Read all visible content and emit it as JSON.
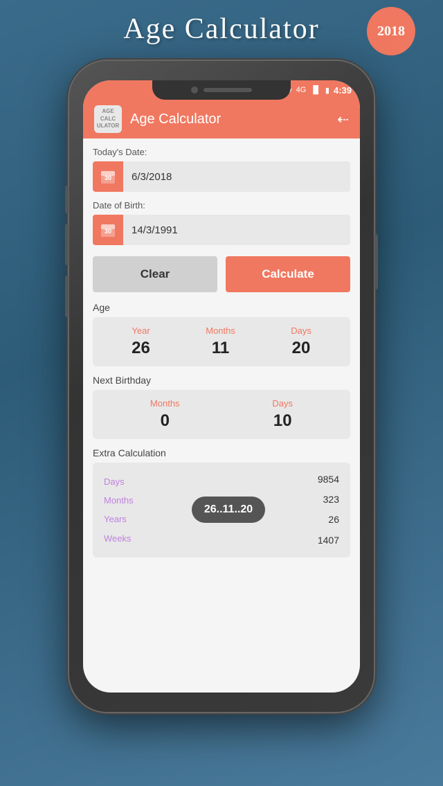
{
  "app": {
    "main_title": "Age Calculator",
    "year_badge": "2018",
    "app_title": "Age Calculator"
  },
  "status_bar": {
    "network": "4G",
    "time": "4:39"
  },
  "form": {
    "today_label": "Today's Date:",
    "today_value": "6/3/2018",
    "dob_label": "Date of Birth:",
    "dob_value": "14/3/1991",
    "clear_button": "Clear",
    "calculate_button": "Calculate"
  },
  "age_section": {
    "label": "Age",
    "year_label": "Year",
    "year_value": "26",
    "months_label": "Months",
    "months_value": "11",
    "days_label": "Days",
    "days_value": "20"
  },
  "birthday_section": {
    "label": "Next Birthday",
    "months_label": "Months",
    "months_value": "0",
    "days_label": "Days",
    "days_value": "10"
  },
  "extra_section": {
    "label": "Extra Calculation",
    "badge_text": "26..11..20",
    "row_labels": [
      "Days",
      "Months",
      "Years",
      "Weeks"
    ],
    "row_values": [
      "9854",
      "323",
      "26",
      "1407"
    ]
  },
  "app_icon_lines": [
    "AGE",
    "CALC",
    "ULATOR"
  ]
}
